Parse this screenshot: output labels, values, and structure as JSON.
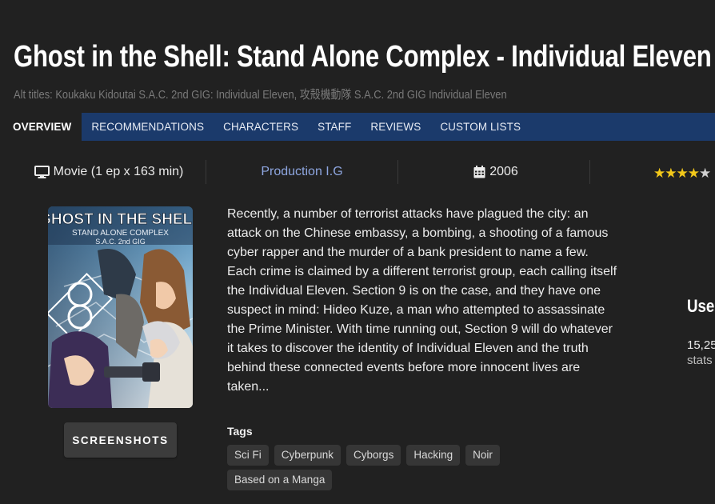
{
  "title": "Ghost in the Shell: Stand Alone Complex - Individual Eleven",
  "alt_titles": "Alt titles: Koukaku Kidoutai S.A.C. 2nd GIG: Individual Eleven, 攻殻機動隊 S.A.C. 2nd GIG Individual Eleven",
  "nav": {
    "items": [
      {
        "label": "OVERVIEW",
        "active": true
      },
      {
        "label": "RECOMMENDATIONS"
      },
      {
        "label": "CHARACTERS"
      },
      {
        "label": "STAFF"
      },
      {
        "label": "REVIEWS"
      },
      {
        "label": "CUSTOM LISTS"
      }
    ]
  },
  "info": {
    "format": "Movie (1 ep x 163 min)",
    "format_icon": "monitor-icon",
    "studio": "Production I.G",
    "year": "2006",
    "year_icon": "calendar-icon",
    "rating_stars": 4,
    "rating_max": 5
  },
  "poster": {
    "title_line1": "GHOST IN THE SHELL",
    "title_line2": "STAND ALONE COMPLEX",
    "title_line3": "S.A.C. 2nd GIG"
  },
  "screenshots_label": "SCREENSHOTS",
  "synopsis": "Recently, a number of terrorist attacks have plagued the city: an attack on the Chinese embassy, a bombing, a shooting of a famous cyber rapper and the murder of a bank president to name a few. Each crime is claimed by a different terrorist group, each calling itself the Individual Eleven. Section 9 is on the case, and they have one suspect in mind: Hideo Kuze, a man who attempted to assassinate the Prime Minister. With time running out, Section 9 will do whatever it takes to discover the identity of Individual Eleven and the truth behind these connected events before more innocent lives are taken...",
  "tags_label": "Tags",
  "tags": [
    "Sci Fi",
    "Cyberpunk",
    "Cyborgs",
    "Hacking",
    "Noir",
    "Based on a Manga"
  ],
  "sidebar": {
    "heading": "User",
    "count": "15,25",
    "stats": "stats"
  },
  "colors": {
    "background": "#212121",
    "nav_bg": "#1b3a6b",
    "studio_link": "#8ea6e0",
    "star": "#f2c81a"
  }
}
